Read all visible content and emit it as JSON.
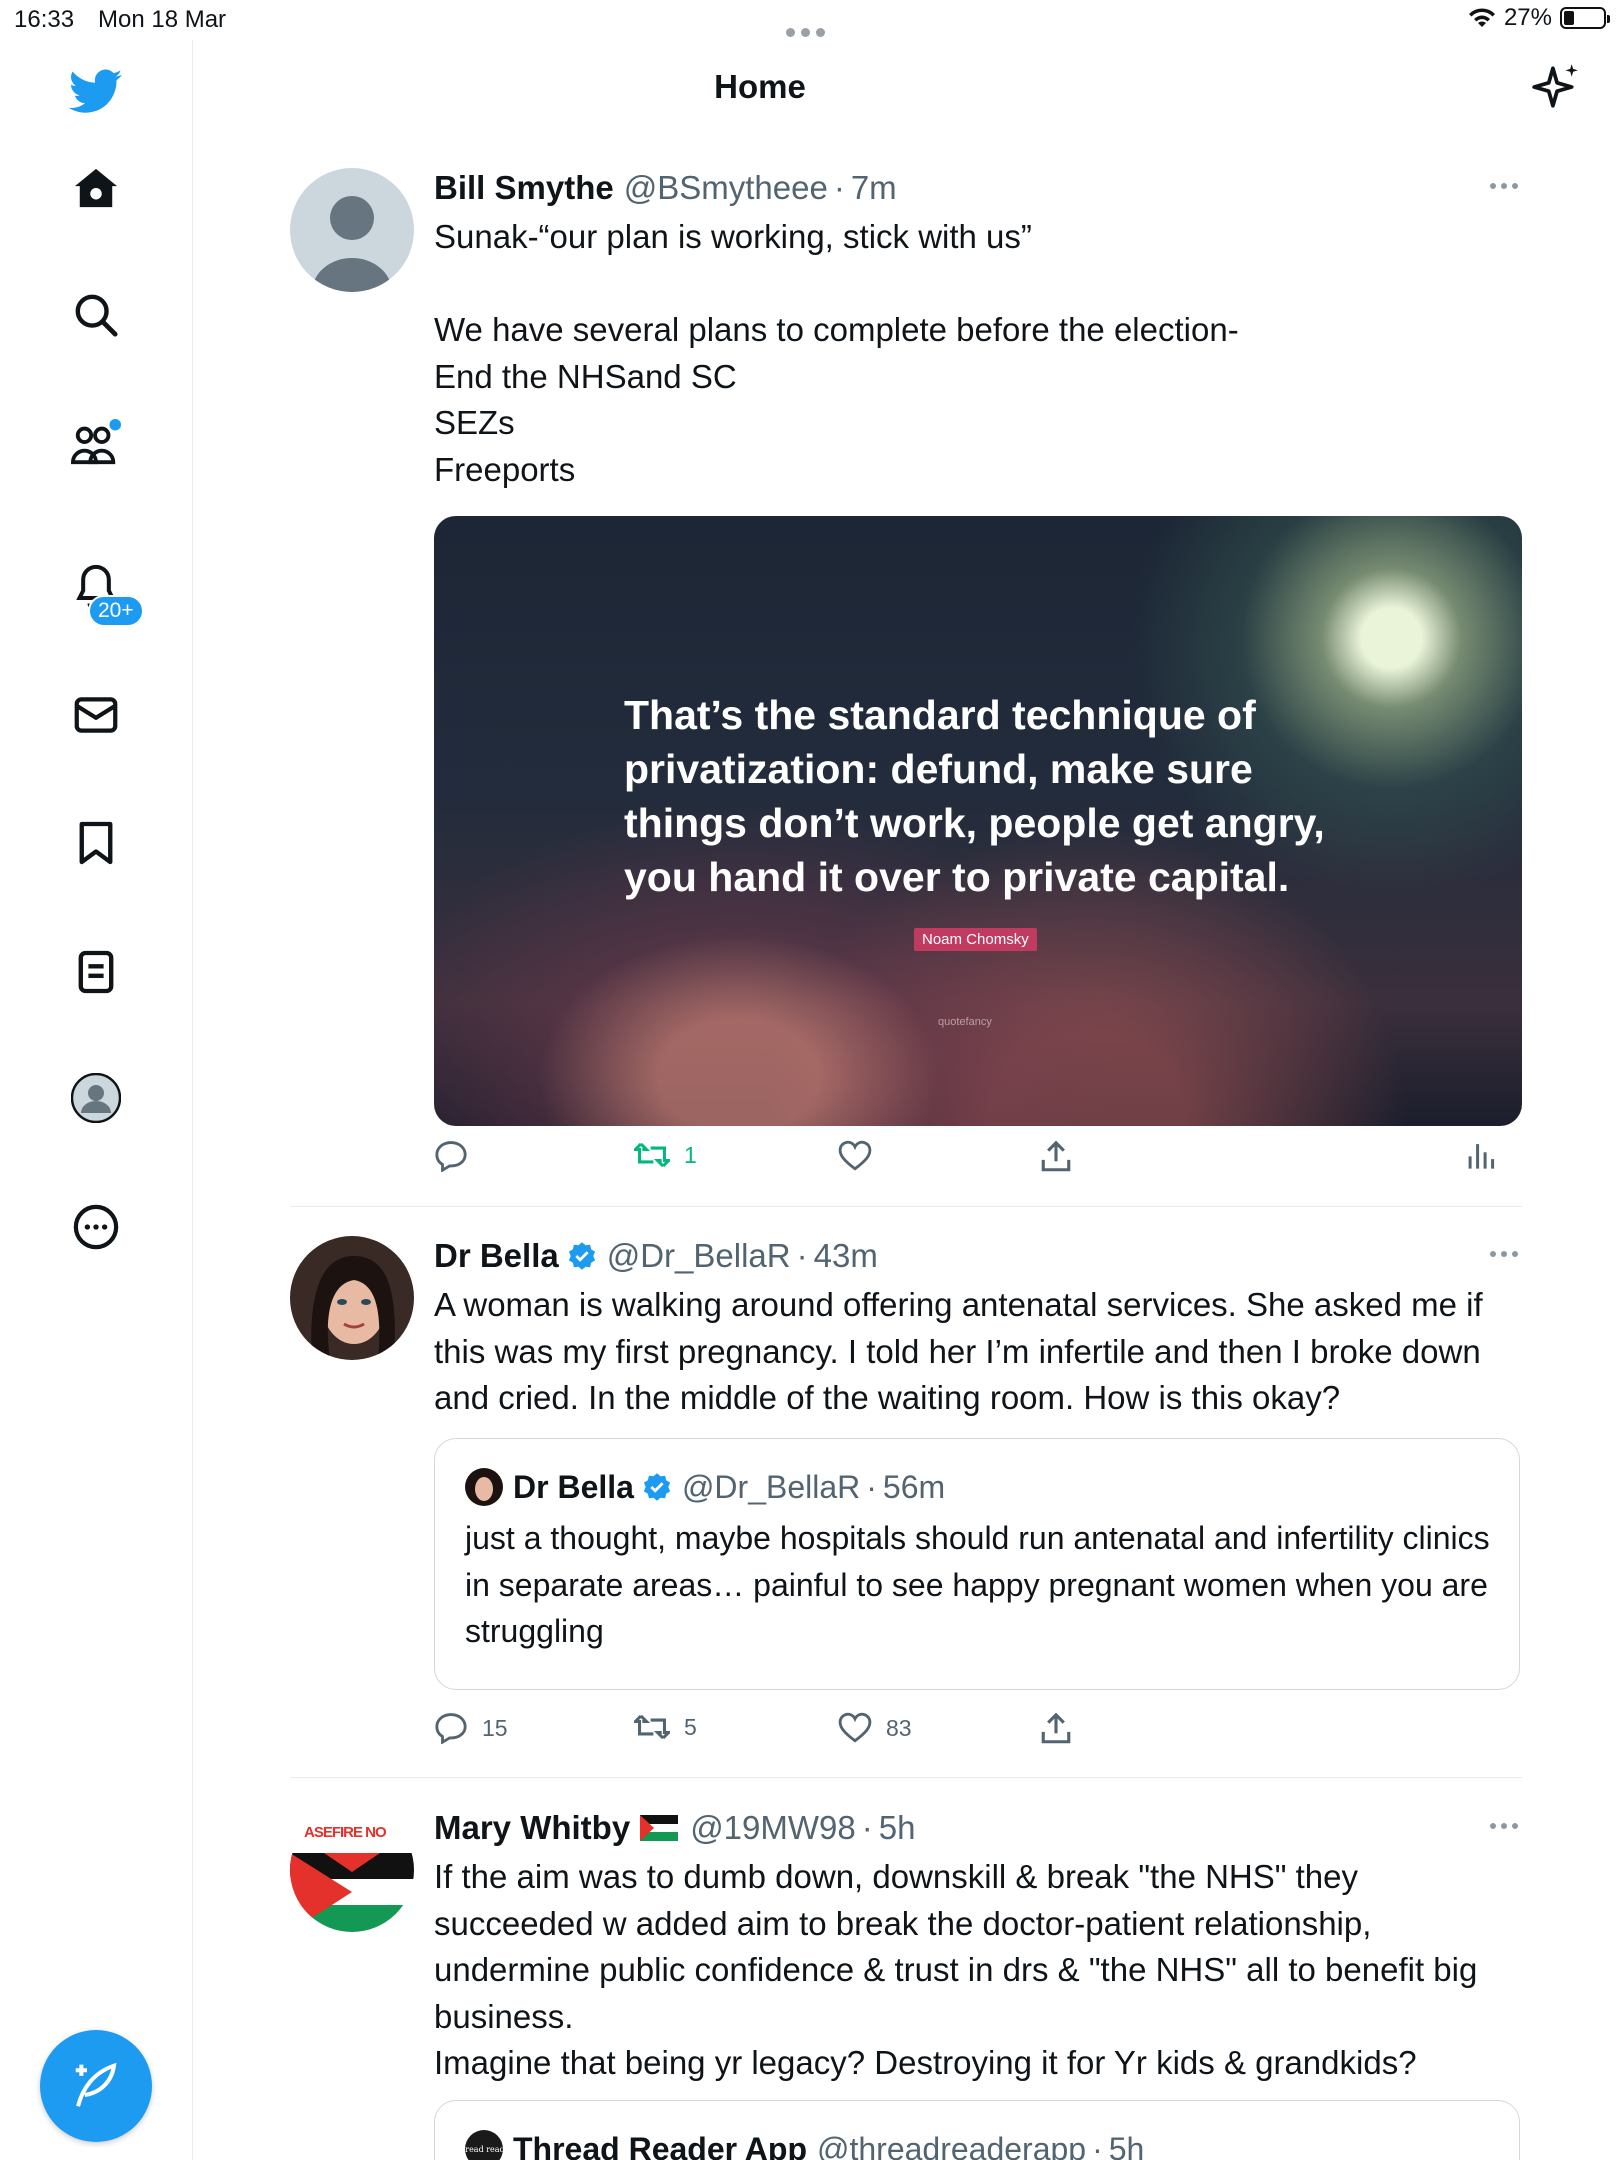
{
  "status_bar": {
    "time": "16:33",
    "date": "Mon 18 Mar",
    "battery": "27%",
    "battery_level": 0.27
  },
  "header": {
    "title": "Home"
  },
  "sidebar": {
    "icons": [
      "twitter-logo-icon",
      "home-icon",
      "search-icon",
      "communities-icon",
      "notifications-icon",
      "messages-icon",
      "bookmarks-icon",
      "lists-icon",
      "profile-icon",
      "more-icon"
    ],
    "notifications_badge": "20+"
  },
  "tweets": [
    {
      "name": "Bill Smythe",
      "handle": "@BSmytheee",
      "time": "7m",
      "text": "Sunak-“our plan is working, stick with us”\n\nWe have several plans to complete before the election-\nEnd the NHSand SC\nSEZs\nFreeports",
      "media": {
        "quote": "That’s the standard technique of privatization: defund, make sure things don’t work, people get angry, you hand it over to private capital.",
        "author": "Noam Chomsky",
        "brand": "quotefancy"
      },
      "retweets": "1"
    },
    {
      "name": "Dr Bella",
      "handle": "@Dr_BellaR",
      "time": "43m",
      "text": "A woman is walking around offering antenatal services. She asked me if this was my first pregnancy. I told her I’m infertile and then I broke down and cried. In the middle of the waiting room. How is this okay?",
      "quoted": {
        "name": "Dr Bella",
        "handle": "@Dr_BellaR",
        "time": "56m",
        "text": "just a thought, maybe hospitals should run antenatal and infertility clinics in separate areas… painful to see happy pregnant women when you are struggling"
      },
      "replies": "15",
      "retweets": "5",
      "likes": "83"
    },
    {
      "name": "Mary Whitby",
      "handle": "@19MW98",
      "time": "5h",
      "avatar_text": "ASEFIRE NO",
      "text": "If the aim was to dumb down, downskill & break \"the NHS\" they succeeded w added aim to break the doctor-patient relationship, undermine public confidence & trust in drs & \"the NHS\" all to benefit big business.\nImagine that being yr legacy? Destroying it for Yr kids & grandkids?",
      "quoted": {
        "name": "Thread Reader App",
        "handle": "@threadreaderapp",
        "time": "5h",
        "avatar_text": "Thread reader"
      }
    }
  ],
  "colors": {
    "accent": "#1d9bf0",
    "retweet_green": "#00ba7c",
    "secondary_text": "#536471"
  }
}
